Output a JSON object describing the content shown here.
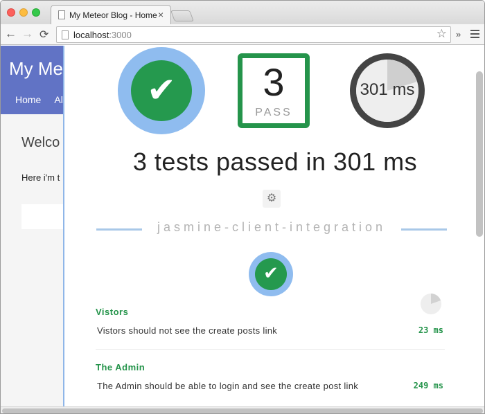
{
  "browser": {
    "tab_title": "My Meteor Blog - Home",
    "tab_close": "×",
    "url_host": "localhost",
    "url_port": ":3000",
    "star": "☆",
    "extensions": "»",
    "back": "←",
    "forward": "→",
    "reload": "⟳"
  },
  "blog": {
    "title": "My Me",
    "nav": [
      "Home",
      "Al"
    ],
    "welcome": "Welco",
    "text": "Here i'm t"
  },
  "velocity": {
    "summary_icon": "checkmark-icon",
    "pass_count": "3",
    "pass_label": "PASS",
    "timer_text": "301 ms",
    "result_line": "3 tests passed in 301 ms",
    "gear": "⚙",
    "framework_name": "jasmine-client-integration",
    "check": "✔",
    "suites": [
      {
        "title": "Vistors",
        "test_name": "Vistors should not see the create posts link",
        "time": "23 ms"
      },
      {
        "title": "The Admin",
        "test_name": "The Admin should be able to login and see the create post link",
        "time": "249 ms"
      }
    ],
    "colors": {
      "pass_green": "#25944b",
      "ring_blue": "#8fbcef"
    }
  }
}
